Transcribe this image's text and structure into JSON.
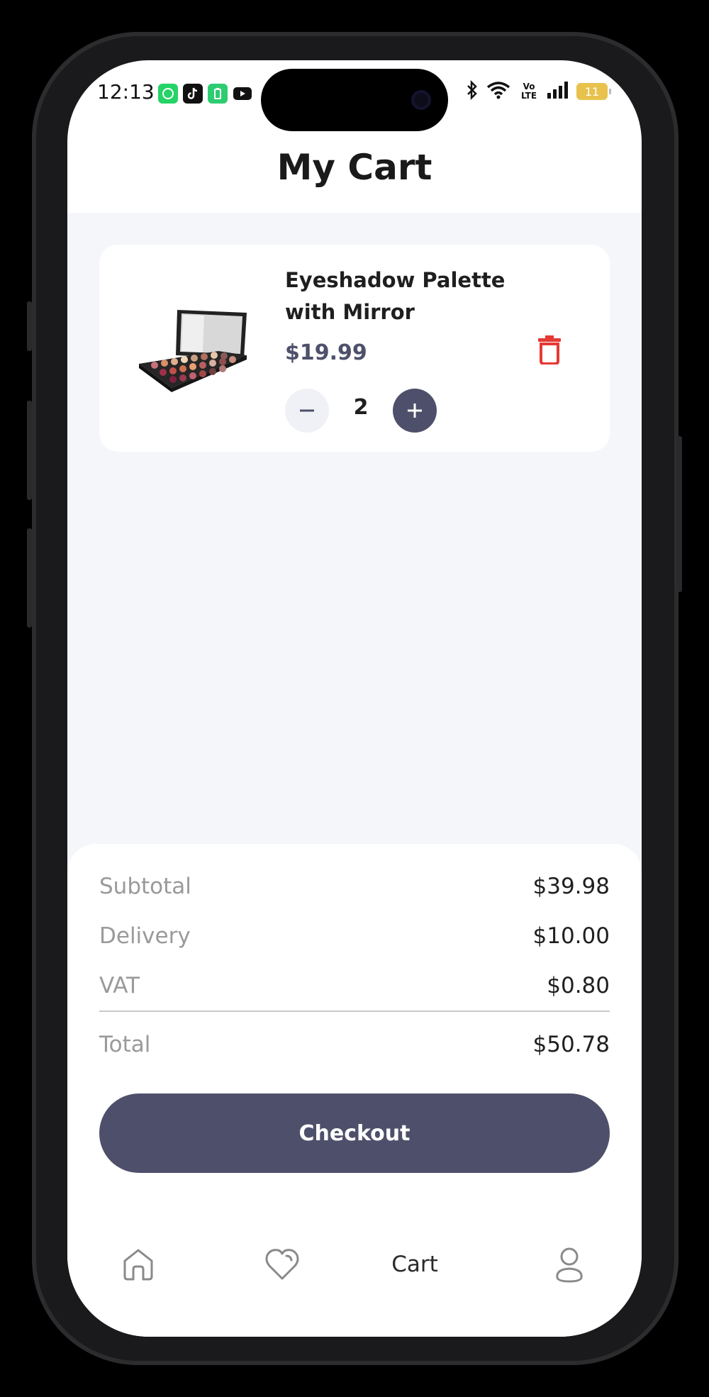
{
  "status_bar": {
    "time": "12:13",
    "apps": [
      "whatsapp-icon",
      "tiktok-icon",
      "battery-saver-icon",
      "youtube-icon"
    ],
    "network": "Vo LTE",
    "battery_level": "11"
  },
  "header": {
    "title": "My Cart"
  },
  "cart": {
    "items": [
      {
        "name": "Eyeshadow Palette with Mirror",
        "price": "$19.99",
        "quantity": "2",
        "image_icon": "eyeshadow-palette-image"
      }
    ]
  },
  "summary": {
    "subtotal_label": "Subtotal",
    "subtotal_value": "$39.98",
    "delivery_label": "Delivery",
    "delivery_value": "$10.00",
    "vat_label": "VAT",
    "vat_value": "$0.80",
    "total_label": "Total",
    "total_value": "$50.78",
    "checkout_label": "Checkout"
  },
  "nav": {
    "items": [
      {
        "icon": "home-icon",
        "label": ""
      },
      {
        "icon": "heart-icon",
        "label": ""
      },
      {
        "icon": "",
        "label": "Cart"
      },
      {
        "icon": "profile-icon",
        "label": ""
      }
    ]
  },
  "colors": {
    "accent": "#4e506b",
    "danger": "#e53935",
    "background": "#f5f6fa"
  }
}
